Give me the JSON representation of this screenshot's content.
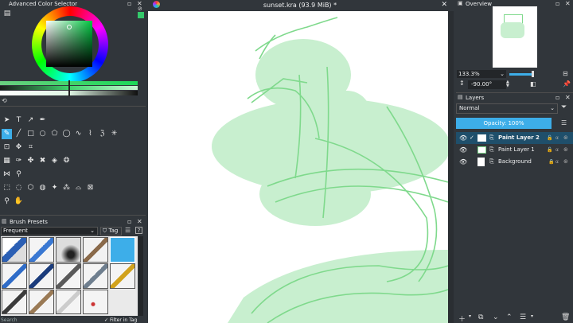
{
  "colors": {
    "bg": "#31363b",
    "panel": "#2a2e32",
    "accent": "#3daee9",
    "canvas": "#ffffff",
    "sketch": "#7fd98c",
    "sketch_fill": "#c8efcf"
  },
  "color_selector": {
    "title": "Advanced Color Selector",
    "icon": "settings-icon"
  },
  "document": {
    "title": "sunset.kra (93.9 MiB) *"
  },
  "brush_presets": {
    "title": "Brush Presets",
    "filter_value": "Frequent",
    "tag_label": "Tag",
    "search_placeholder": "Search",
    "filter_in_tag_label": "Filter in Tag"
  },
  "overview": {
    "title": "Overview",
    "zoom_value": "133.3%",
    "rotation_value": "-90.00°"
  },
  "layers": {
    "title": "Layers",
    "blend_mode": "Normal",
    "opacity_label": "Opacity:  100%",
    "items": [
      {
        "name": "Paint Layer 2",
        "selected": true
      },
      {
        "name": "Paint Layer 1",
        "selected": false
      },
      {
        "name": "Background",
        "selected": false
      }
    ]
  }
}
